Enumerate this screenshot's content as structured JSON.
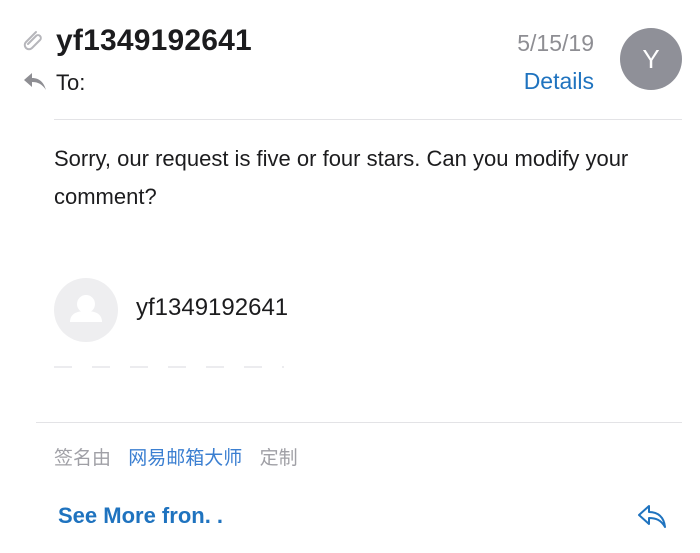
{
  "header": {
    "sender": "yf1349192641",
    "to_label": "To:",
    "date": "5/15/19",
    "details_label": "Details",
    "avatar_initial": "Y"
  },
  "message": {
    "body": "Sorry, our request is five or four stars. Can you modify your comment?"
  },
  "signature": {
    "name": "yf1349192641",
    "prefix": "签名由",
    "app_link": "网易邮箱大师",
    "suffix": "定制"
  },
  "footer": {
    "see_more_label": "See More fron. ."
  },
  "icons": [
    "paperclip-icon",
    "reply-arrow-icon",
    "person-placeholder-icon",
    "reply-icon"
  ],
  "colors": {
    "accent": "#1f73bf",
    "avatar_bg": "#8f9098",
    "muted_text": "#8e8e93"
  }
}
